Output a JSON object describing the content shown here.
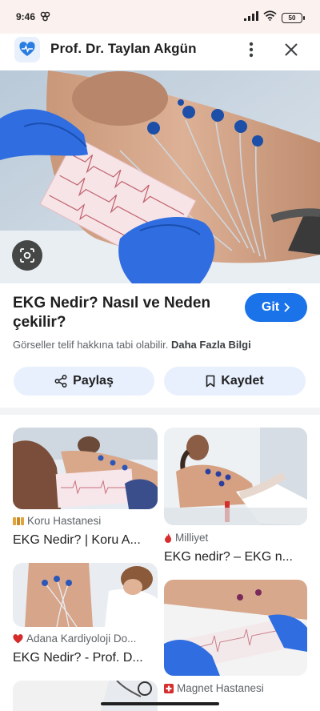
{
  "status_bar": {
    "time": "9:46",
    "battery": "50"
  },
  "header": {
    "title": "Prof. Dr. Taylan Akgün"
  },
  "result": {
    "title": "EKG Nedir? Nasıl ve Neden çekilir?",
    "visit_label": "Git",
    "copyright_notice": "Görseller telif hakkına tabi olabilir.",
    "more_info_link": "Daha Fazla Bilgi"
  },
  "actions": {
    "share_label": "Paylaş",
    "save_label": "Kaydet"
  },
  "related": [
    {
      "source": "Koru Hastanesi",
      "title": "EKG Nedir? | Koru A..."
    },
    {
      "source": "Milliyet",
      "title": "EKG nedir? – EKG n..."
    },
    {
      "source": "Adana Kardiyoloji Do...",
      "title": "EKG Nedir? - Prof. D..."
    },
    {
      "source": "Magnet Hastanesi",
      "title": ""
    }
  ],
  "colors": {
    "accent": "#1a73e8",
    "pill_bg": "#e8f0fe",
    "status_bg": "#fbf1ee"
  }
}
